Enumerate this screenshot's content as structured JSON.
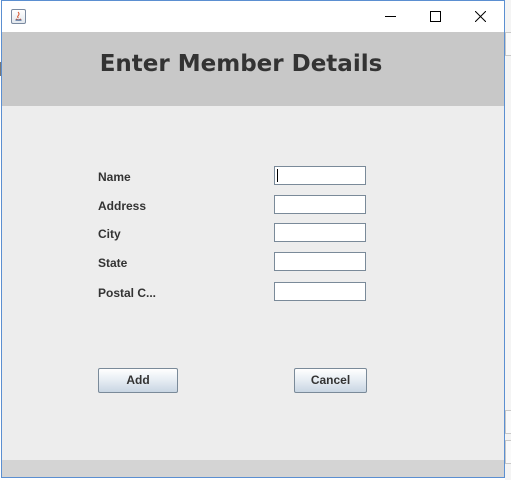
{
  "window": {
    "controls": {
      "minimize": "minimize-icon",
      "maximize": "maximize-icon",
      "close": "close-icon"
    }
  },
  "header": {
    "title": "Enter Member Details"
  },
  "form": {
    "fields": [
      {
        "label": "Name",
        "value": ""
      },
      {
        "label": "Address",
        "value": ""
      },
      {
        "label": "City",
        "value": ""
      },
      {
        "label": "State",
        "value": ""
      },
      {
        "label": "Postal C...",
        "value": ""
      }
    ]
  },
  "buttons": {
    "add_label": "Add",
    "cancel_label": "Cancel"
  },
  "colors": {
    "header_bg": "#c8c8c8",
    "content_bg": "#ededed",
    "window_border": "#5b8fd1"
  }
}
